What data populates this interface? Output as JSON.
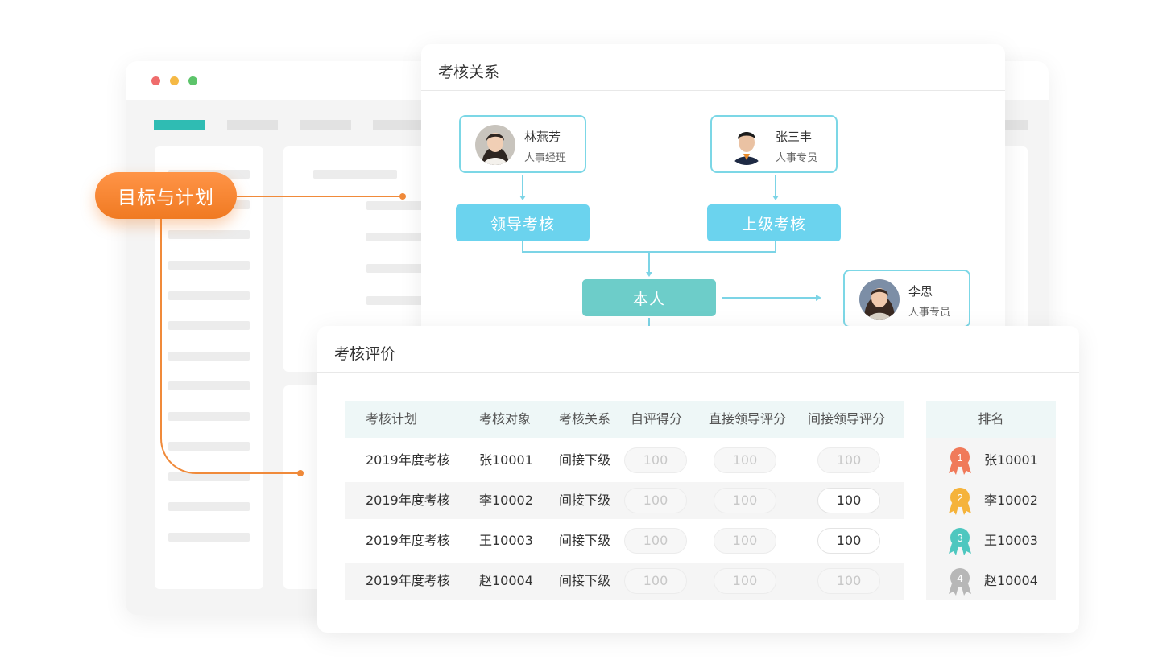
{
  "tag": {
    "label": "目标与计划"
  },
  "relation": {
    "title": "考核关系",
    "leader_person": {
      "name": "林燕芳",
      "role": "人事经理"
    },
    "superior_person": {
      "name": "张三丰",
      "role": "人事专员"
    },
    "leader_review": "领导考核",
    "superior_review": "上级考核",
    "self": "本人",
    "subordinate_person": {
      "name": "李思",
      "role": "人事专员"
    }
  },
  "evaluation": {
    "title": "考核评价",
    "columns": [
      "考核计划",
      "考核对象",
      "考核关系",
      "自评得分",
      "直接领导评分",
      "间接领导评分"
    ],
    "rows": [
      {
        "plan": "2019年度考核",
        "target": "张10001",
        "relation": "间接下级",
        "self_score": "100",
        "direct_score": "100",
        "indirect_score": "100"
      },
      {
        "plan": "2019年度考核",
        "target": "李10002",
        "relation": "间接下级",
        "self_score": "100",
        "direct_score": "100",
        "indirect_score": "100"
      },
      {
        "plan": "2019年度考核",
        "target": "王10003",
        "relation": "间接下级",
        "self_score": "100",
        "direct_score": "100",
        "indirect_score": "100"
      },
      {
        "plan": "2019年度考核",
        "target": "赵10004",
        "relation": "间接下级",
        "self_score": "100",
        "direct_score": "100",
        "indirect_score": "100"
      }
    ],
    "ranking": {
      "header": "排名",
      "items": [
        {
          "rank": "1",
          "name": "张10001",
          "color": "#f07a5a"
        },
        {
          "rank": "2",
          "name": "李10002",
          "color": "#f5b33b"
        },
        {
          "rank": "3",
          "name": "王10003",
          "color": "#4ec7bf"
        },
        {
          "rank": "4",
          "name": "赵10004",
          "color": "#b7b7b7"
        }
      ]
    }
  },
  "colors": {
    "accent_orange": "#f07a22",
    "accent_teal": "#2fbcb3",
    "flow_blue": "#6bd3ee"
  }
}
